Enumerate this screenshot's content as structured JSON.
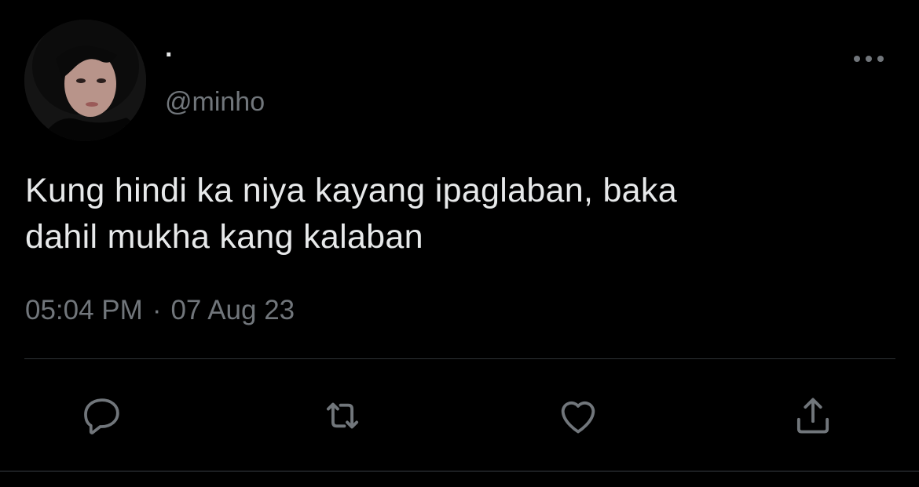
{
  "tweet": {
    "display_name": "·",
    "handle": "@minho",
    "text_line1": "Kung hindi ka niya kayang ipaglaban, baka",
    "text_line2": "dahil mukha kang kalaban",
    "time": "05:04 PM",
    "separator": "·",
    "date": "07 Aug 23"
  },
  "icons": {
    "more": "more-horizontal-icon",
    "reply": "reply-icon",
    "retweet": "retweet-icon",
    "like": "heart-icon",
    "share": "share-icon"
  },
  "colors": {
    "background": "#000000",
    "text": "#e7e9ea",
    "secondary": "#71767b",
    "divider": "#2f3336"
  }
}
